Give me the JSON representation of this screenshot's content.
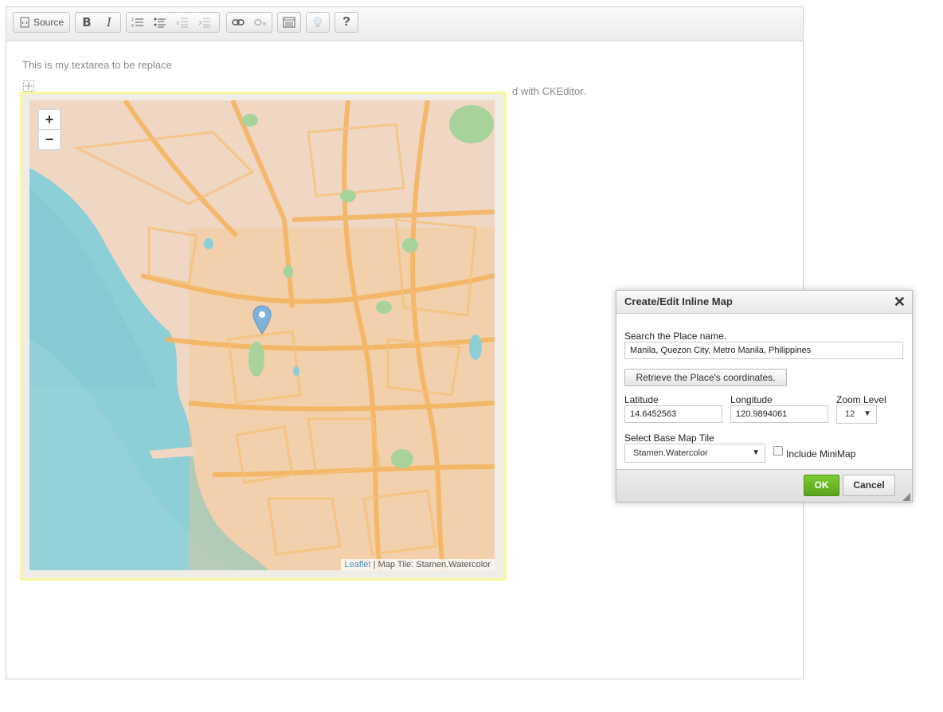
{
  "toolbar": {
    "source_label": "Source",
    "bold_label": "B",
    "italic_label": "I",
    "help_label": "?"
  },
  "content": {
    "text_part1": "This is my textarea to be replace",
    "text_part2": "d with CKEditor."
  },
  "map": {
    "zoom_in": "+",
    "zoom_out": "−",
    "attribution_link": "Leaflet",
    "attribution_text": " | Map Tile: Stamen.Watercolor",
    "colors": {
      "water": "#8ccfd6",
      "land": "#efd7c4",
      "roads": "#f4b35c",
      "park": "#a7d39a",
      "marker": "#7fb3dc"
    }
  },
  "dialog": {
    "title": "Create/Edit Inline Map",
    "close": "✕",
    "search_label": "Search the Place name.",
    "search_value": "Manila, Quezon City, Metro Manila, Philippines",
    "retrieve_button": "Retrieve the Place's coordinates.",
    "latitude_label": "Latitude",
    "latitude_value": "14.6452563",
    "longitude_label": "Longitude",
    "longitude_value": "120.9894061",
    "zoom_label": "Zoom Level",
    "zoom_value": "12",
    "basemap_label": "Select Base Map Tile",
    "basemap_value": "Stamen.Watercolor",
    "minimap_label": "Include MiniMap",
    "minimap_checked": false,
    "ok_button": "OK",
    "cancel_button": "Cancel",
    "ok_color": "#6bb62a"
  }
}
